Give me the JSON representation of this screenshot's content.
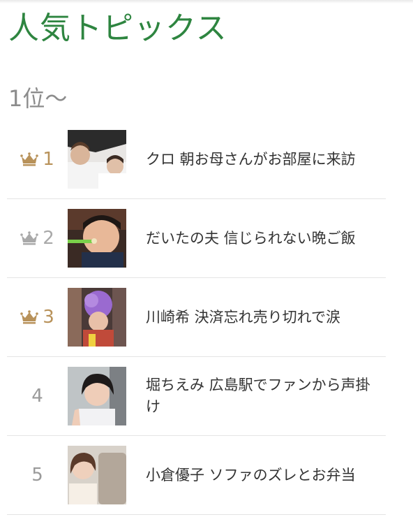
{
  "header": {
    "title": "人気トピックス",
    "subtitle": "1位〜"
  },
  "colors": {
    "title": "#2e8540",
    "gold_crown": "#b8925a",
    "silver_crown": "#a9a9a9"
  },
  "topics": [
    {
      "rank": "1",
      "crown": "gold-crown-icon",
      "headline": "クロ 朝お母さんがお部屋に来訪"
    },
    {
      "rank": "2",
      "crown": "silver-crown-icon",
      "headline": "だいたの夫 信じられない晩ご飯"
    },
    {
      "rank": "3",
      "crown": "bronze-crown-icon",
      "headline": "川崎希 決済忘れ売り切れで涙"
    },
    {
      "rank": "4",
      "crown": "",
      "headline": "堀ちえみ 広島駅でファンから声掛け"
    },
    {
      "rank": "5",
      "crown": "",
      "headline": "小倉優子 ソファのズレとお弁当"
    }
  ]
}
